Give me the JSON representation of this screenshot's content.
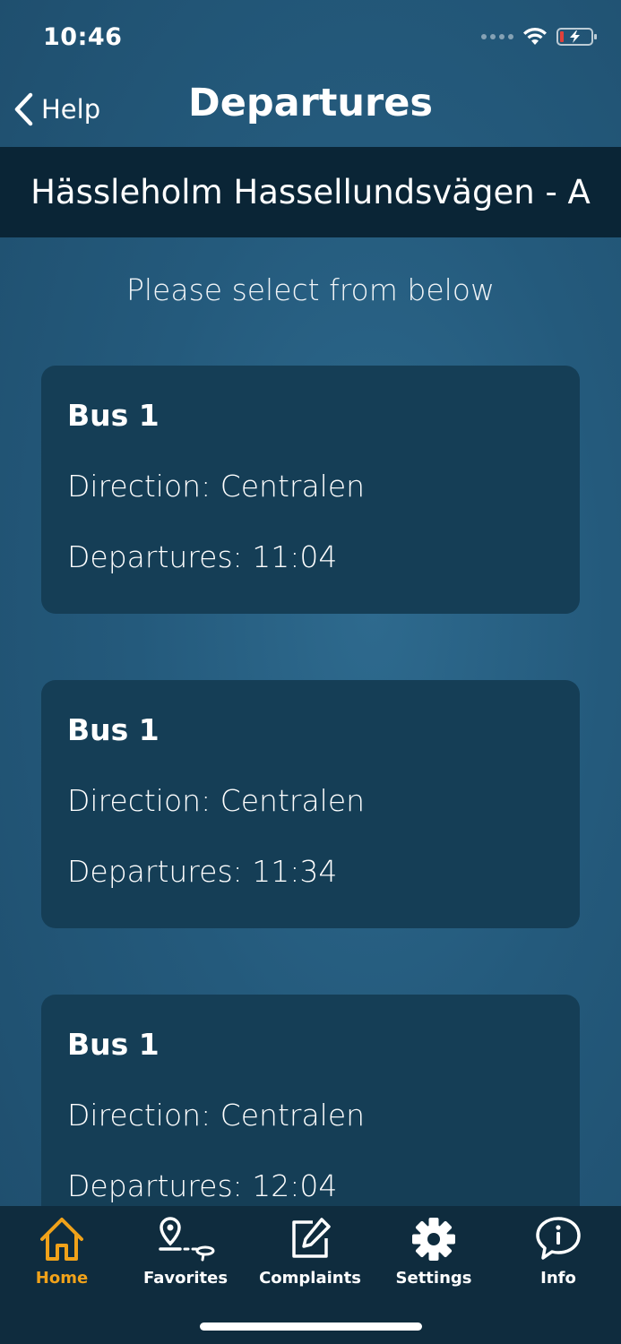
{
  "status_bar": {
    "time": "10:46",
    "battery_low_color": "#e0413b"
  },
  "nav": {
    "back_label": "Help",
    "title": "Departures"
  },
  "stop": {
    "name": "Hässleholm Hassellundsvägen - A"
  },
  "instruction": "Please select from below",
  "departures": [
    {
      "route": "Bus 1",
      "direction": "Direction: Centralen",
      "departure": "Departures: 11:04"
    },
    {
      "route": "Bus 1",
      "direction": "Direction: Centralen",
      "departure": "Departures: 11:34"
    },
    {
      "route": "Bus 1",
      "direction": "Direction: Centralen",
      "departure": "Departures: 12:04"
    }
  ],
  "tabs": [
    {
      "label": "Home",
      "icon": "home-icon",
      "active": true
    },
    {
      "label": "Favorites",
      "icon": "route-pin-icon",
      "active": false
    },
    {
      "label": "Complaints",
      "icon": "edit-icon",
      "active": false
    },
    {
      "label": "Settings",
      "icon": "gear-icon",
      "active": false
    },
    {
      "label": "Info",
      "icon": "info-bubble-icon",
      "active": false
    }
  ],
  "colors": {
    "accent": "#f0a21a",
    "header_band": "#0a2536",
    "card": "#153e56",
    "tab_bar": "#0f2c3e"
  }
}
